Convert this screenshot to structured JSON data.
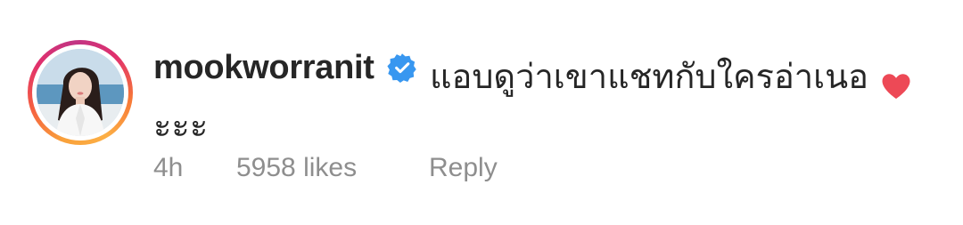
{
  "comment": {
    "username": "mookworranit",
    "verified_icon": "verified-badge-icon",
    "text_line1": "แอบดูว่าเขาแชทกับใครอ่าเนอ",
    "text_line2": "ะะะ",
    "time": "4h",
    "likes": "5958 likes",
    "reply_label": "Reply",
    "liked": true,
    "heart_icon": "heart-filled-icon"
  },
  "colors": {
    "verified_blue": "#3897f0",
    "heart_red": "#ed4956",
    "meta_gray": "#8e8e8e",
    "text": "#262626"
  }
}
